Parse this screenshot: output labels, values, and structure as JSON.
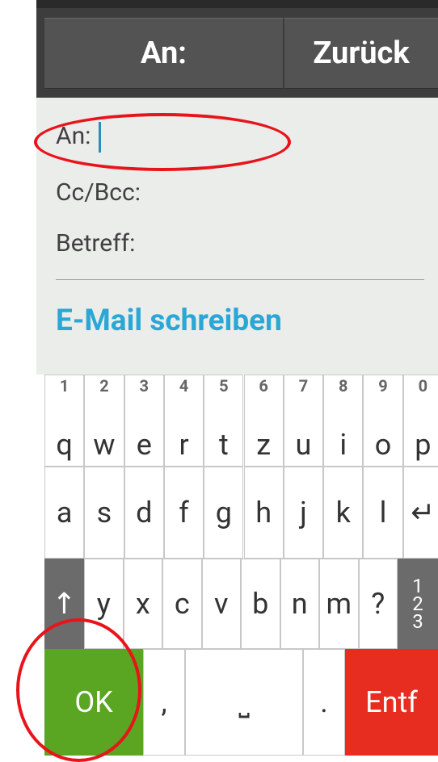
{
  "header": {
    "left_button": "An:",
    "right_button": "Zurück"
  },
  "form": {
    "to_label": "An:",
    "cc_label": "Cc/Bcc:",
    "subject_label": "Betreff:",
    "compose_label": "E-Mail schreiben"
  },
  "keyboard": {
    "row1": [
      {
        "letter": "q",
        "num": "1"
      },
      {
        "letter": "w",
        "num": "2"
      },
      {
        "letter": "e",
        "num": "3"
      },
      {
        "letter": "r",
        "num": "4"
      },
      {
        "letter": "t",
        "num": "5"
      },
      {
        "letter": "z",
        "num": "6"
      },
      {
        "letter": "u",
        "num": "7"
      },
      {
        "letter": "i",
        "num": "8"
      },
      {
        "letter": "o",
        "num": "9"
      },
      {
        "letter": "p",
        "num": "0"
      }
    ],
    "row2": [
      "a",
      "s",
      "d",
      "f",
      "g",
      "h",
      "j",
      "k",
      "l",
      "↵"
    ],
    "row3": {
      "shift": "↑",
      "keys": [
        "y",
        "x",
        "c",
        "v",
        "b",
        "n",
        "m",
        "?"
      ],
      "num_switch": [
        "1",
        "2",
        "3"
      ]
    },
    "row4": {
      "ok": "OK",
      "comma": ",",
      "space": "⎵",
      "period": ".",
      "delete": "Entf"
    }
  },
  "colors": {
    "ok": "#5aa522",
    "delete": "#e62d1f",
    "accent": "#2ba7d6",
    "annotation": "#e8141b"
  }
}
